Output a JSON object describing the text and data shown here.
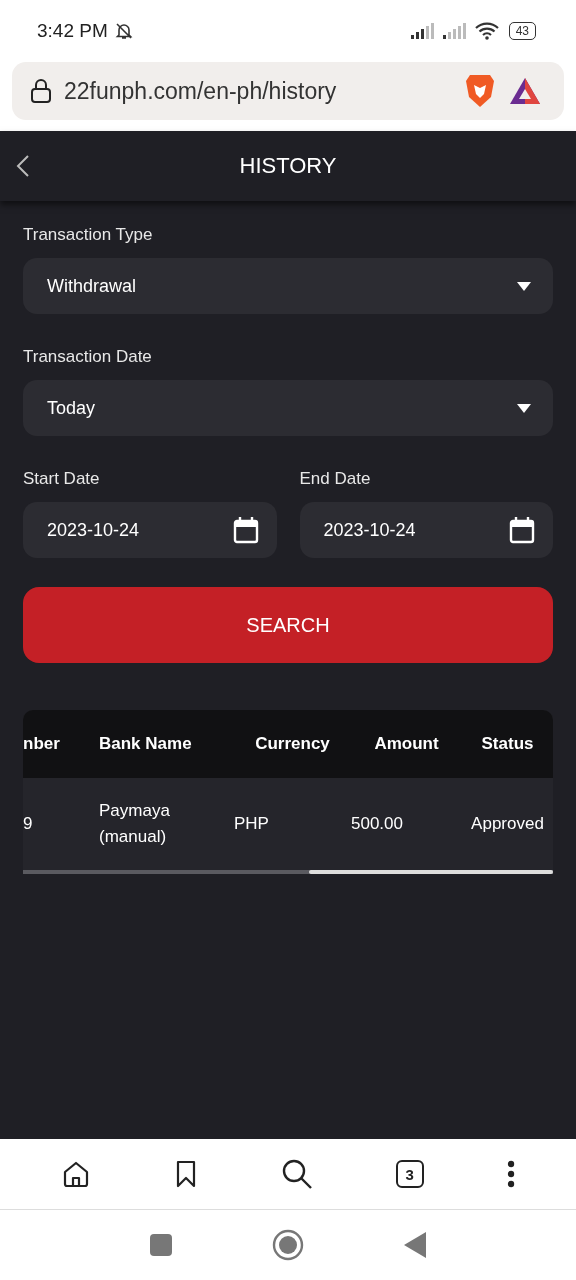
{
  "status_bar": {
    "time": "3:42 PM",
    "battery": "43"
  },
  "browser": {
    "url": "22funph.com/en-ph/history",
    "tab_count": "3"
  },
  "header": {
    "title": "HISTORY"
  },
  "form": {
    "transaction_type": {
      "label": "Transaction Type",
      "value": "Withdrawal"
    },
    "transaction_date": {
      "label": "Transaction Date",
      "value": "Today"
    },
    "start_date": {
      "label": "Start Date",
      "value": "2023-10-24"
    },
    "end_date": {
      "label": "End Date",
      "value": "2023-10-24"
    },
    "search_button": "SEARCH"
  },
  "table": {
    "columns": [
      "nber",
      "Bank Name",
      "Currency",
      "Amount",
      "Status"
    ],
    "rows": [
      [
        "9",
        "Paymaya (manual)",
        "PHP",
        "500.00",
        "Approved"
      ]
    ]
  }
}
